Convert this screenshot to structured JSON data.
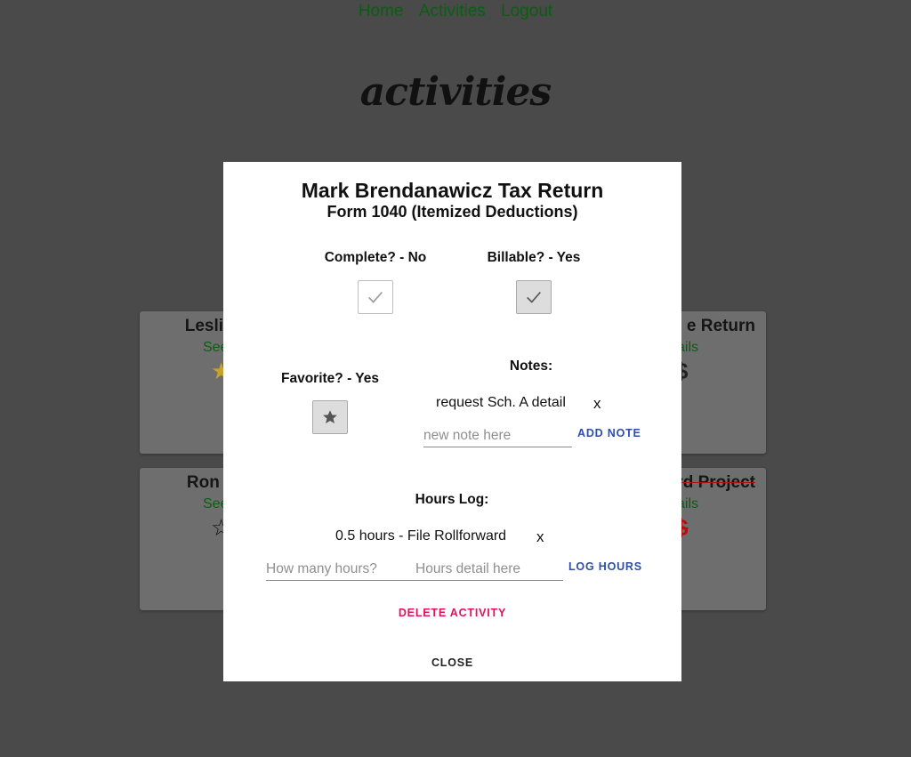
{
  "nav": {
    "items": [
      "Home",
      "Activities",
      "Logout"
    ]
  },
  "page": {
    "title": "activities"
  },
  "cards": [
    {
      "title": "Leslie Kn",
      "link": "See",
      "icon": "★"
    },
    {
      "title": "e Return",
      "link": "ails",
      "icon": "$"
    },
    {
      "title": "Ron Swa",
      "link": "See",
      "icon": "☆"
    },
    {
      "title": "rd Project",
      "link": "ails",
      "icon": "$"
    }
  ],
  "modal": {
    "title": "Mark Brendanawicz Tax Return",
    "subtitle": "Form 1040 (Itemized Deductions)",
    "complete": {
      "label": "Complete? - No",
      "checked": false
    },
    "billable": {
      "label": "Billable? - Yes",
      "checked": true
    },
    "favorite": {
      "label": "Favorite? - Yes",
      "checked": true
    },
    "notes": {
      "label": "Notes:",
      "items": [
        {
          "text": "request Sch. A detail",
          "remove": "x"
        }
      ],
      "input_placeholder": "new note here",
      "add_button": "ADD NOTE"
    },
    "hours": {
      "label": "Hours Log:",
      "items": [
        {
          "text": "0.5 hours - File Rollforward",
          "remove": "x"
        }
      ],
      "hours_placeholder": "How many hours?",
      "detail_placeholder": "Hours detail here",
      "log_button": "LOG HOURS"
    },
    "delete_button": "DELETE ACTIVITY",
    "close_button": "CLOSE"
  },
  "colors": {
    "link": "#0b5d12",
    "backdrop": "#4a4a4a",
    "primary_button": "#2f4fa5",
    "danger_button": "#e0115f",
    "favorite_star": "#c9a227"
  }
}
